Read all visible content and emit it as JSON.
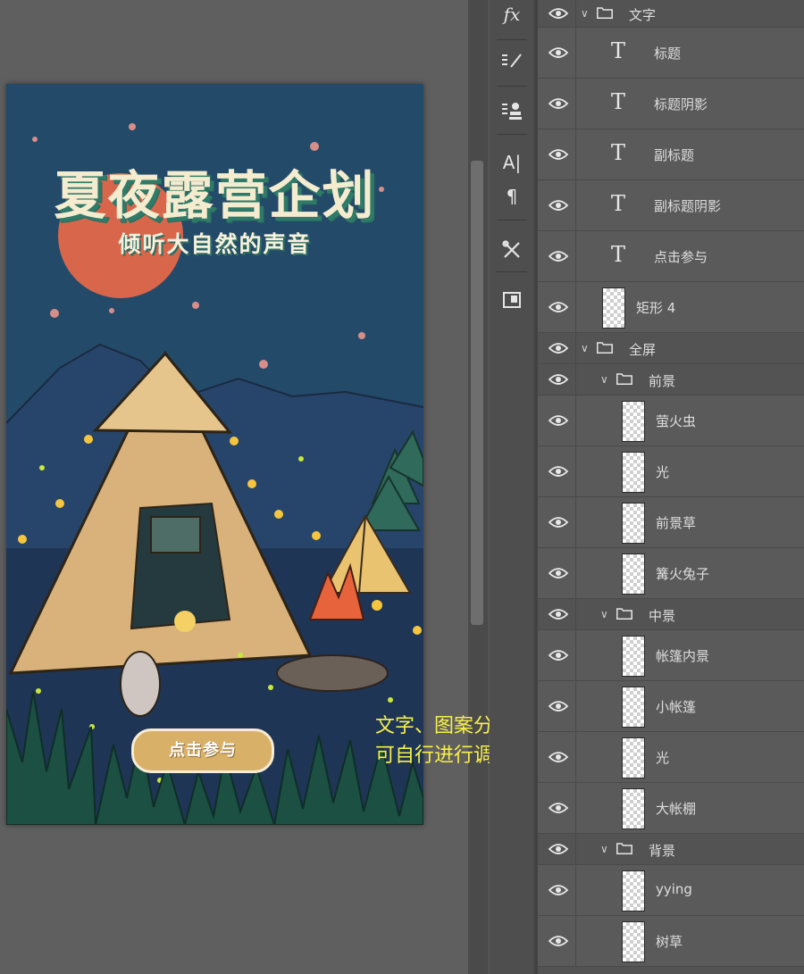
{
  "poster": {
    "title": "夏夜露营企划",
    "subtitle": "倾听大自然的声音",
    "button_label": "点击参与"
  },
  "annotation": {
    "line1": "文字、图案分层整理，",
    "line2": "可自行进行调整"
  },
  "toolbar": {
    "fx_label": "fx",
    "char_label": "A|",
    "para_label": "¶"
  },
  "layers": {
    "group_text": "文字",
    "title": "标题",
    "title_shadow": "标题阴影",
    "subtitle": "副标题",
    "subtitle_shadow": "副标题阴影",
    "join": "点击参与",
    "rect4": "矩形 4",
    "group_fullscreen": "全屏",
    "group_foreground": "前景",
    "fireflies": "萤火虫",
    "light1": "光",
    "foreground_grass": "前景草",
    "bonfire_rabbit": "篝火兔子",
    "group_midground": "中景",
    "tent_interior": "帐篷内景",
    "small_tent": "小帐篷",
    "light2": "光",
    "big_tent": "大帐棚",
    "group_background": "背景",
    "yying": "yying",
    "trees_grass": "树草"
  },
  "colors": {
    "sky": "#244c6a",
    "moon": "#d8664a",
    "annotation": "#f7f04a",
    "button": "#d9b067"
  }
}
